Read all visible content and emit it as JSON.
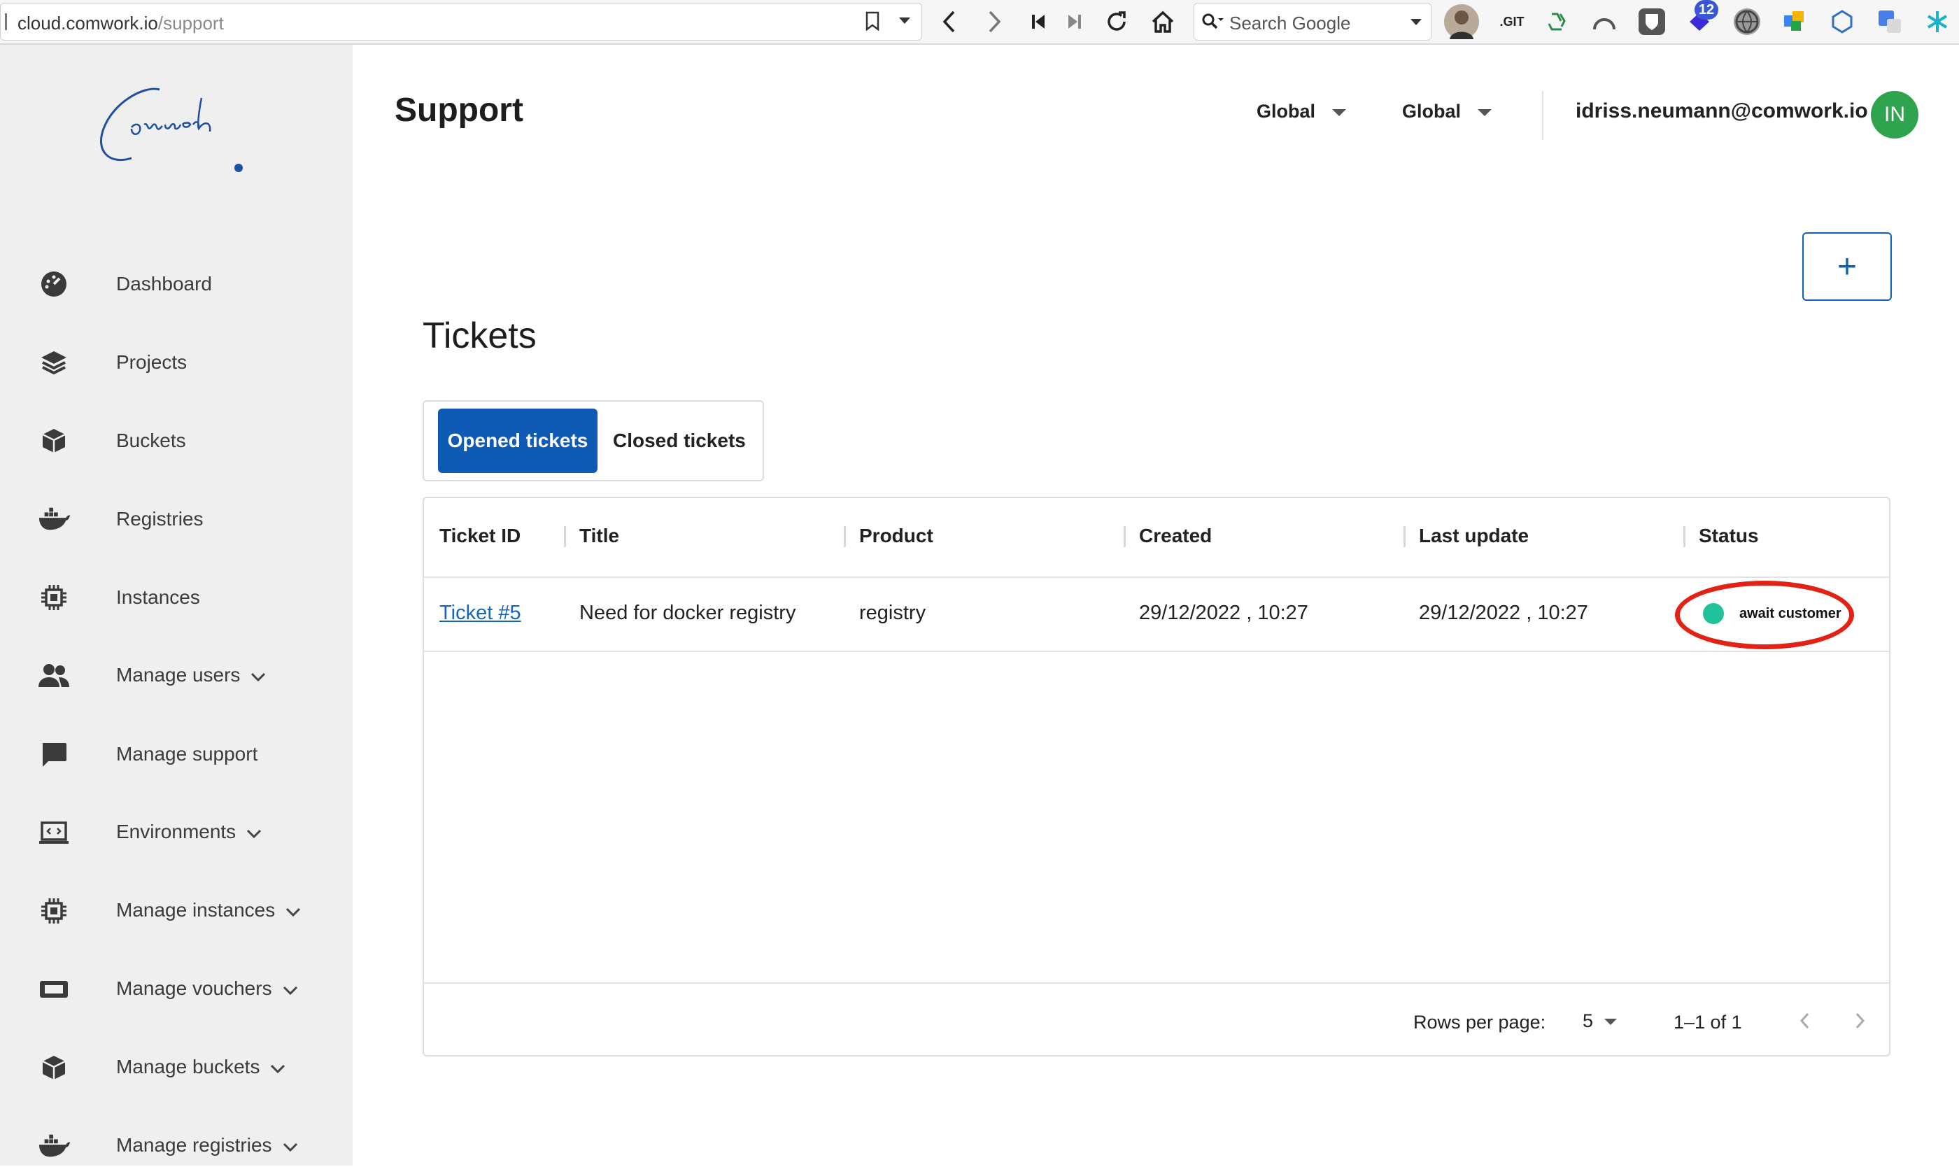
{
  "browser": {
    "url_host": "cloud.comwork.io",
    "url_path": "/support",
    "search_placeholder": "Search Google",
    "ext_badge": "12",
    "ext_git_label": ".GIT"
  },
  "sidebar": {
    "logo_text": "Comwork",
    "items": [
      {
        "label": "Dashboard"
      },
      {
        "label": "Projects"
      },
      {
        "label": "Buckets"
      },
      {
        "label": "Registries"
      },
      {
        "label": "Instances"
      },
      {
        "label": "Manage users"
      },
      {
        "label": "Manage support"
      },
      {
        "label": "Environments"
      },
      {
        "label": "Manage instances"
      },
      {
        "label": "Manage vouchers"
      },
      {
        "label": "Manage buckets"
      },
      {
        "label": "Manage registries"
      }
    ]
  },
  "header": {
    "title": "Support",
    "region_select": "Global",
    "zone_select": "Global",
    "user_email": "idriss.neumann@comwork.io",
    "avatar_initials": "IN"
  },
  "main": {
    "add_button_label": "+",
    "section_title": "Tickets",
    "tabs": [
      {
        "label": "Opened tickets",
        "active": true
      },
      {
        "label": "Closed tickets",
        "active": false
      }
    ],
    "table": {
      "columns": [
        "Ticket ID",
        "Title",
        "Product",
        "Created",
        "Last update",
        "Status"
      ],
      "rows": [
        {
          "ticket_id": "Ticket #5",
          "title": "Need for docker registry",
          "product": "registry",
          "created": "29/12/2022 , 10:27",
          "last_update": "29/12/2022 , 10:27",
          "status": "await customer"
        }
      ],
      "footer": {
        "rows_per_page_label": "Rows per page:",
        "rows_per_page_value": "5",
        "range_text": "1–1 of 1"
      }
    }
  },
  "colors": {
    "primary": "#0f5ab5",
    "status_dot": "#1fc29a",
    "annotation_ring": "#e22215",
    "avatar": "#2ea44f",
    "sidebar_bg": "#efefef"
  }
}
